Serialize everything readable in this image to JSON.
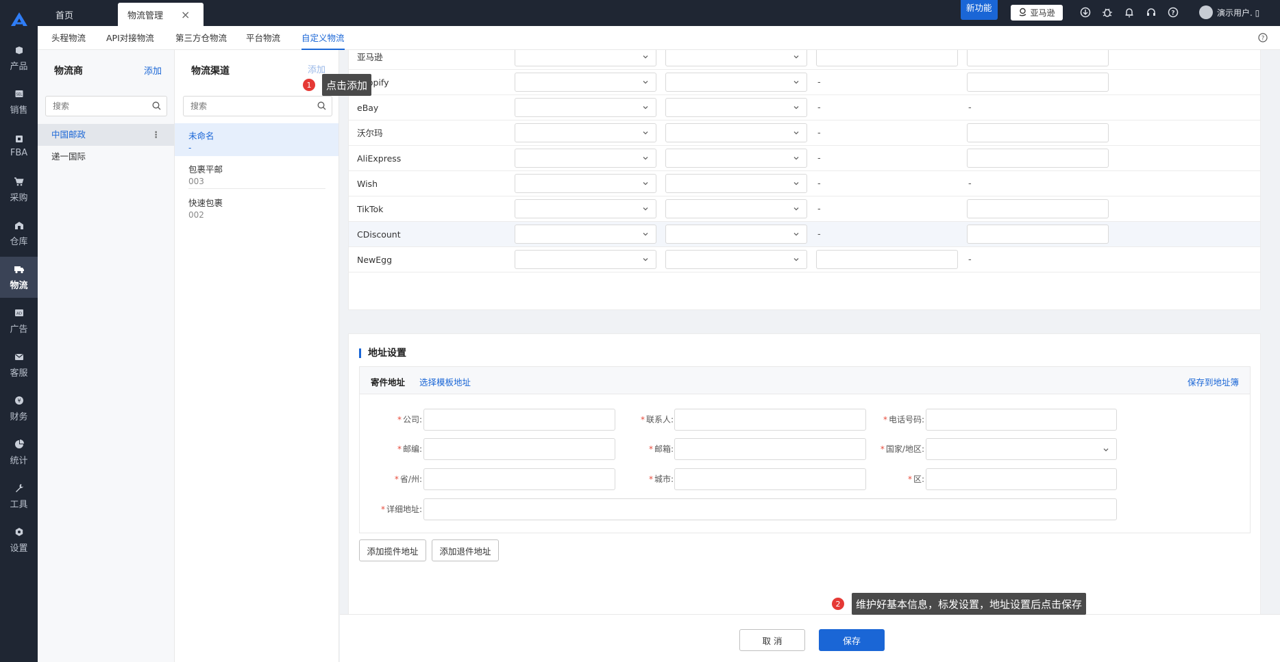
{
  "nav": {
    "items": [
      {
        "label": "产品",
        "icon": "box-icon"
      },
      {
        "label": "销售",
        "icon": "sales-icon"
      },
      {
        "label": "FBA",
        "icon": "fba-icon"
      },
      {
        "label": "采购",
        "icon": "cart-icon"
      },
      {
        "label": "仓库",
        "icon": "warehouse-icon"
      },
      {
        "label": "物流",
        "icon": "truck-icon"
      },
      {
        "label": "广告",
        "icon": "ad-icon"
      },
      {
        "label": "客服",
        "icon": "mail-icon"
      },
      {
        "label": "财务",
        "icon": "finance-icon"
      },
      {
        "label": "统计",
        "icon": "pie-icon"
      },
      {
        "label": "工具",
        "icon": "wrench-icon"
      },
      {
        "label": "设置",
        "icon": "settings-icon"
      }
    ],
    "active_index": 5
  },
  "topbar": {
    "tabs": [
      {
        "label": "首页"
      },
      {
        "label": "物流管理"
      }
    ],
    "close_glyph": "×",
    "new_feature": "新功能",
    "marketplace": "亚马逊",
    "user": "演示用户. ▯"
  },
  "subnav": {
    "items": [
      "头程物流",
      "API对接物流",
      "第三方仓物流",
      "平台物流",
      "自定义物流"
    ],
    "active_index": 4
  },
  "carrier_panel": {
    "title": "物流商",
    "add": "添加",
    "search_placeholder": "搜索",
    "items": [
      "中国邮政",
      "递一国际"
    ],
    "active_index": 0
  },
  "channel_panel": {
    "title": "物流渠道",
    "add": "添加",
    "search_placeholder": "搜索",
    "items": [
      {
        "name": "未命名",
        "code": "-"
      },
      {
        "name": "包裹平邮",
        "code": "003"
      },
      {
        "name": "快速包裹",
        "code": "002"
      }
    ],
    "active_index": 0
  },
  "platform_table": {
    "rows": [
      {
        "name": "亚马逊",
        "col3": "input",
        "col4": "input"
      },
      {
        "name": "Shopify",
        "col3": "-",
        "col4": "input"
      },
      {
        "name": "eBay",
        "col3": "-",
        "col4": "-"
      },
      {
        "name": "沃尔玛",
        "col3": "-",
        "col4": "input"
      },
      {
        "name": "AliExpress",
        "col3": "-",
        "col4": "input"
      },
      {
        "name": "Wish",
        "col3": "-",
        "col4": "-"
      },
      {
        "name": "TikTok",
        "col3": "-",
        "col4": "input"
      },
      {
        "name": "CDiscount",
        "col3": "-",
        "col4": "input"
      },
      {
        "name": "NewEgg",
        "col3": "input",
        "col4": "-"
      }
    ],
    "highlight_index": 7
  },
  "address": {
    "section_title": "地址设置",
    "sender_label": "寄件地址",
    "select_template": "选择模板地址",
    "save_to_book": "保存到地址簿",
    "fields": {
      "company": "公司:",
      "contact": "联系人:",
      "phone": "电话号码:",
      "zip": "邮编:",
      "email": "邮箱:",
      "country": "国家/地区:",
      "province": "省/州:",
      "city": "城市:",
      "district": "区:",
      "detail": "详细地址:"
    },
    "required_mark": "*",
    "add_pickup": "添加揽件地址",
    "add_return": "添加退件地址"
  },
  "footer": {
    "cancel": "取 消",
    "save": "保存"
  },
  "tips": {
    "step1": {
      "num": "1",
      "text": "点击添加"
    },
    "step2": {
      "num": "2",
      "text": "维护好基本信息，标发设置，地址设置后点击保存"
    }
  },
  "colors": {
    "accent": "#1a66d6",
    "nav_bg": "#1f2633",
    "step": "#e53935"
  }
}
